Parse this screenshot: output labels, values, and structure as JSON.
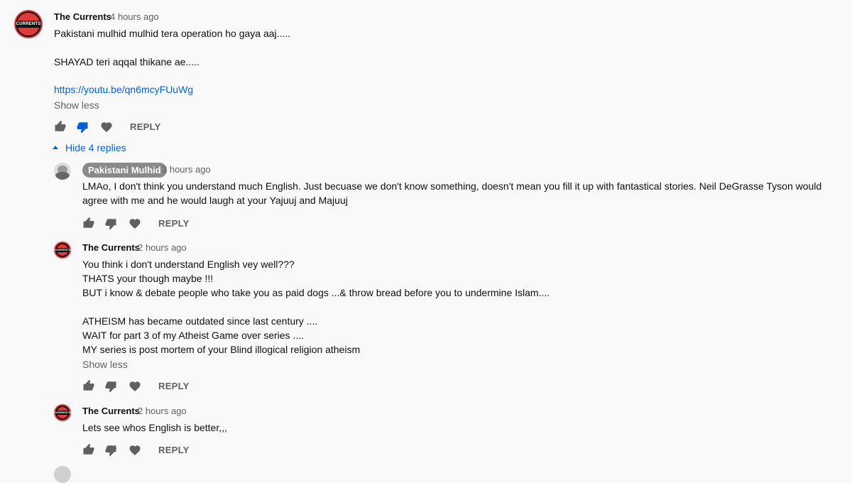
{
  "top_comment": {
    "author": "The Currents",
    "time": "4 hours ago",
    "avatar_text": "CURRENTS",
    "lines": [
      "Pakistani mulhid mulhid tera operation  ho gaya aaj.....",
      "SHAYAD teri aqqal thikane ae....."
    ],
    "link": "https://youtu.be/qn6mcyFUuWg",
    "show_less": "Show less",
    "reply": "REPLY",
    "disliked": true
  },
  "hide_replies_label": "Hide 4 replies",
  "replies": [
    {
      "author": "Pakistani Mulhid",
      "author_is_owner_chip": true,
      "time": "3 hours ago",
      "lines": [
        "LMAo, I don't think you understand much English. Just becuase we don't know something, doesn't mean you fill it up with fantastical stories. Neil DeGrasse Tyson would",
        "agree with me and he would laugh at your Yajuuj and Majuuj"
      ],
      "reply": "REPLY"
    },
    {
      "author": "The Currents",
      "time": "2 hours ago",
      "avatar_text": "CURRENTS",
      "lines": [
        "You think i don't  understand English  vey well???",
        "THATS your though  maybe !!!",
        "BUT i know & debate people who take you as paid dogs ...& throw bread before you to undermine  Islam....",
        "",
        "ATHEISM has became  outdated  since  last century ....",
        "WAIT for part 3 of my Atheist Game over series ....",
        "MY series is post mortem of your Blind illogical  religion  atheism"
      ],
      "show_less": "Show less",
      "reply": "REPLY"
    },
    {
      "author": "The Currents",
      "time": "2 hours ago",
      "avatar_text": "CURRENTS",
      "lines": [
        "Lets see whos English  is better,,,"
      ],
      "reply": "REPLY"
    }
  ],
  "colors": {
    "link": "#065fd4",
    "meta": "#606060",
    "icon": "#606060",
    "avatar_red": "#e23b3b"
  }
}
